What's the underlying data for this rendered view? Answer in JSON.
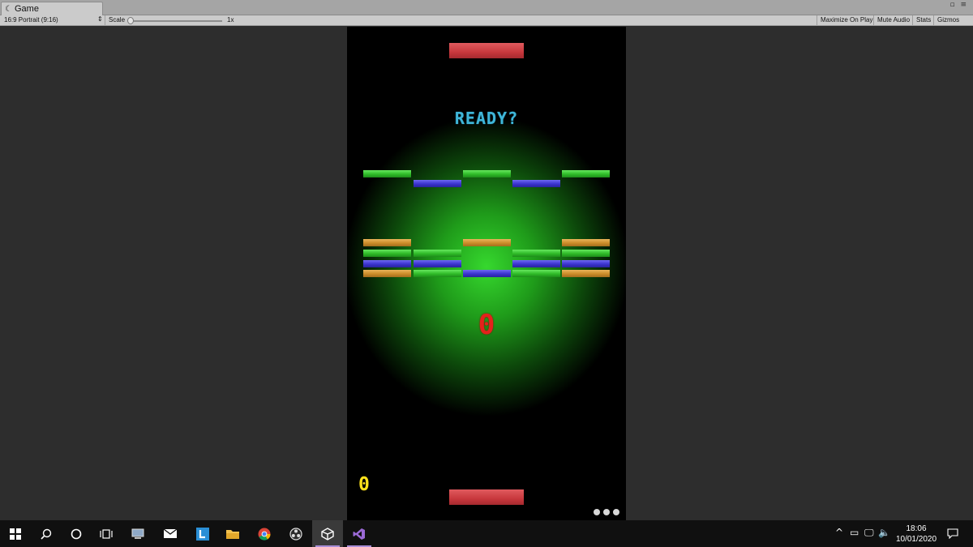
{
  "window": {
    "tab_title": "Game",
    "controls": "▫ ≡"
  },
  "toolbar": {
    "aspect": "16:9 Portrait (9:16)",
    "scale_label": "Scale",
    "scale_value": "1x",
    "maximize_on_play": "Maximize On Play",
    "mute_audio": "Mute Audio",
    "stats": "Stats",
    "gizmos": "Gizmos"
  },
  "game": {
    "status_text": "READY?",
    "center_score": "0",
    "player_score": "0",
    "brick_colors": {
      "green": "#2fbb28",
      "blue": "#3a33cf",
      "orange": "#cb8c2a"
    },
    "paddle_color": "#c8383d"
  },
  "taskbar": {
    "time": "18:06",
    "date": "10/01/2020",
    "icons": [
      "windows-start-icon",
      "search-icon",
      "cortana-icon",
      "task-view-icon",
      "computer-icon",
      "mail-icon",
      "l-app-icon",
      "file-explorer-icon",
      "chrome-icon",
      "obs-icon",
      "unity-icon",
      "visual-studio-icon"
    ]
  }
}
